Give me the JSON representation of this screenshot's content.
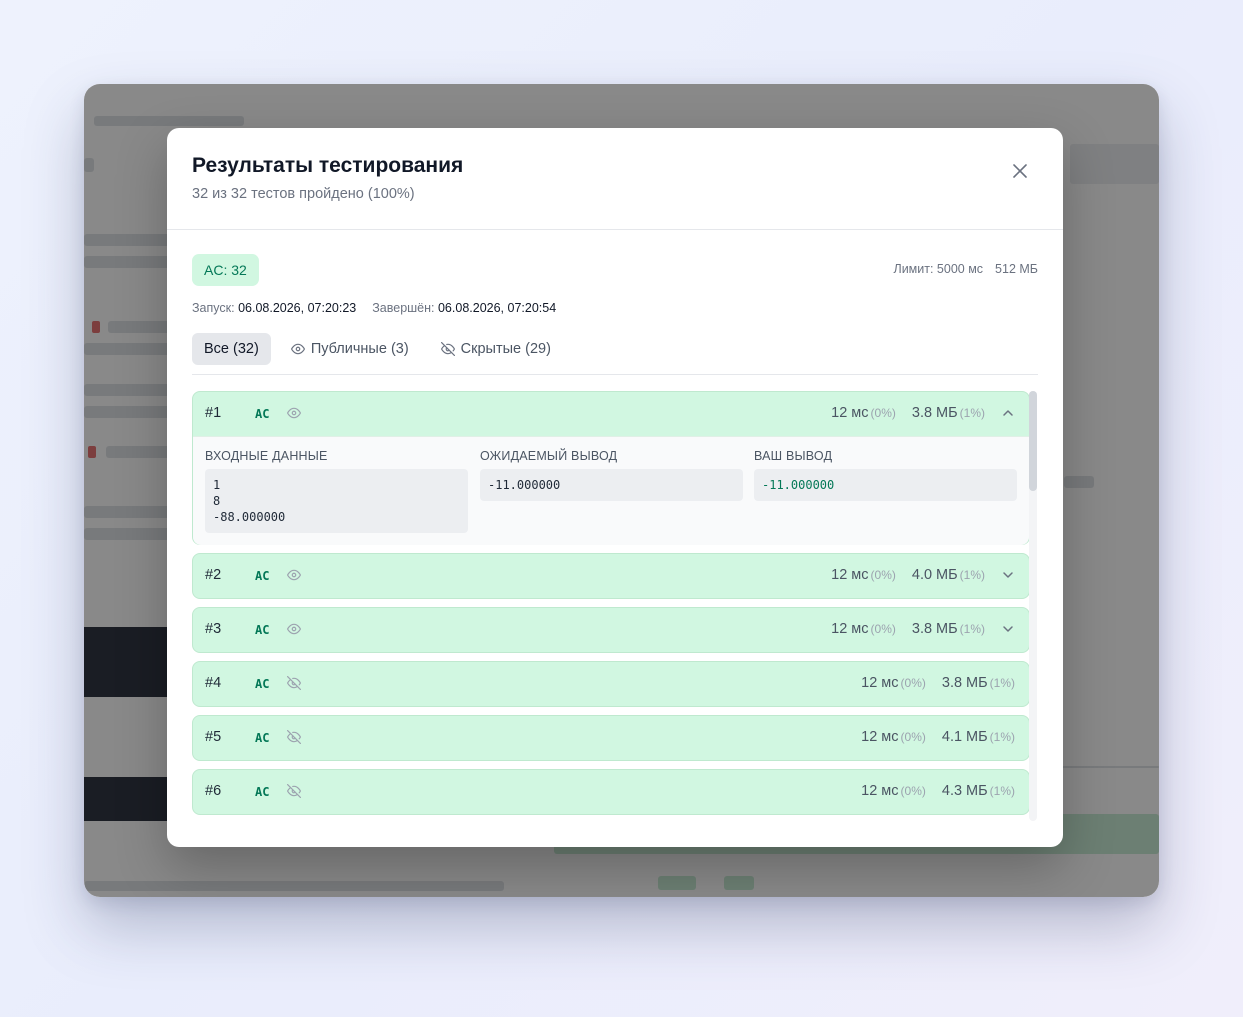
{
  "modal": {
    "title": "Результаты тестирования",
    "subtitle": "32 из 32 тестов пройдено (100%)"
  },
  "summary": {
    "verdict_badge": "AC: 32",
    "time_limit": "Лимит: 5000 мс",
    "memory_limit": "512 МБ",
    "start_label": "Запуск:",
    "start_value": "06.08.2026, 07:20:23",
    "end_label": "Завершён:",
    "end_value": "06.08.2026, 07:20:54"
  },
  "tabs": [
    {
      "label": "Все (32)",
      "icon": "none",
      "active": true
    },
    {
      "label": "Публичные (3)",
      "icon": "eye-icon",
      "active": false
    },
    {
      "label": "Скрытые (29)",
      "icon": "eye-off-icon",
      "active": false
    }
  ],
  "io_labels": {
    "input": "ВХОДНЫЕ ДАННЫЕ",
    "expected": "ОЖИДАЕМЫЙ ВЫВОД",
    "actual": "ВАШ ВЫВОД"
  },
  "tests": [
    {
      "num": "#1",
      "verdict": "AC",
      "visibility": "eye-icon",
      "time": "12 мс",
      "time_pct": "(0%)",
      "mem": "3.8 МБ",
      "mem_pct": "(1%)",
      "expanded": true,
      "input": "1\n8\n-88.000000",
      "expected": "-11.000000",
      "actual": "-11.000000"
    },
    {
      "num": "#2",
      "verdict": "AC",
      "visibility": "eye-icon",
      "time": "12 мс",
      "time_pct": "(0%)",
      "mem": "4.0 МБ",
      "mem_pct": "(1%)",
      "expanded": false
    },
    {
      "num": "#3",
      "verdict": "AC",
      "visibility": "eye-icon",
      "time": "12 мс",
      "time_pct": "(0%)",
      "mem": "3.8 МБ",
      "mem_pct": "(1%)",
      "expanded": false
    },
    {
      "num": "#4",
      "verdict": "AC",
      "visibility": "eye-off-icon",
      "time": "12 мс",
      "time_pct": "(0%)",
      "mem": "3.8 МБ",
      "mem_pct": "(1%)",
      "expanded": false
    },
    {
      "num": "#5",
      "verdict": "AC",
      "visibility": "eye-off-icon",
      "time": "12 мс",
      "time_pct": "(0%)",
      "mem": "4.1 МБ",
      "mem_pct": "(1%)",
      "expanded": false
    },
    {
      "num": "#6",
      "verdict": "AC",
      "visibility": "eye-off-icon",
      "time": "12 мс",
      "time_pct": "(0%)",
      "mem": "4.3 МБ",
      "mem_pct": "(1%)",
      "expanded": false
    }
  ],
  "colors": {
    "row_bg": "#d1f7e1",
    "accent_green": "#047857",
    "overlay": "rgba(40,40,40,0.55)"
  }
}
